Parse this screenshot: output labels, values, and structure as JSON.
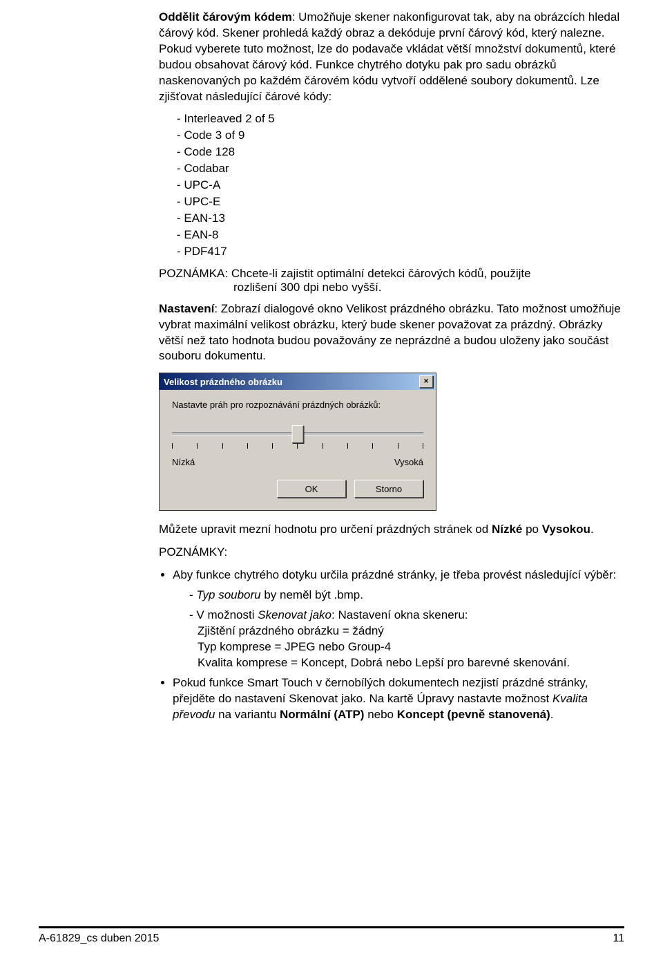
{
  "p1a": "Oddělit čárovým kódem",
  "p1b": ": Umožňuje skener nakonfigurovat tak, aby na obrázcích hledal čárový kód. Skener prohledá každý obraz a dekóduje první čárový kód, který nalezne. Pokud vyberete tuto možnost, lze do podavače vkládat větší množství dokumentů, které budou obsahovat čárový kód. Funkce chytrého dotyku pak pro sadu obrázků naskenovaných po každém čárovém kódu vytvoří oddělené soubory dokumentů. Lze zjišťovat následující čárové kódy:",
  "barcodes": [
    "Interleaved 2 of 5",
    "Code 3 of 9",
    "Code 128",
    "Codabar",
    "UPC-A",
    "UPC-E",
    "EAN-13",
    "EAN-8",
    "PDF417"
  ],
  "note1a": "POZNÁMKA: Chcete-li zajistit optimální detekci čárových kódů, použijte",
  "note1b": "rozlišení 300 dpi nebo vyšší.",
  "p2a": "Nastavení",
  "p2b": ": Zobrazí dialogové okno Velikost prázdného obrázku. Tato možnost umožňuje vybrat maximální velikost obrázku, který bude skener považovat za prázdný. Obrázky větší než tato hodnota budou považovány ze neprázdné a budou uloženy jako součást souboru dokumentu.",
  "dialog": {
    "title": "Velikost prázdného obrázku",
    "text": "Nastavte práh pro rozpoznávání prázdných obrázků:",
    "low": "Nízká",
    "high": "Vysoká",
    "ok": "OK",
    "cancel": "Storno"
  },
  "p3a": "Můžete upravit mezní hodnotu pro určení prázdných stránek od ",
  "p3b": "Nízké",
  "p3c": " po ",
  "p3d": "Vysokou",
  "p3e": ".",
  "notes_label": "POZNÁMKY:",
  "b1": "Aby funkce chytrého dotyku určila prázdné stránky, je třeba provést následující výběr:",
  "d1a": "Typ souboru",
  "d1b": " by neměl být .bmp.",
  "d2a": "V možnosti ",
  "d2b": "Skenovat jako",
  "d2c": ": Nastavení okna skeneru:",
  "d2_l1": "Zjištění prázdného obrázku = žádný",
  "d2_l2": "Typ komprese = JPEG nebo Group-4",
  "d2_l3": "Kvalita komprese = Koncept, Dobrá nebo Lepší pro barevné skenování.",
  "b2a": "Pokud funkce Smart Touch v černobílých dokumentech nezjistí prázdné stránky, přejděte do nastavení Skenovat jako. Na kartě Úpravy nastavte možnost ",
  "b2b": "Kvalita převodu",
  "b2c": " na variantu ",
  "b2d": "Normální (ATP)",
  "b2e": " nebo ",
  "b2f": "Koncept (pevně stanovená)",
  "b2g": ".",
  "footer_left": "A-61829_cs  duben 2015",
  "footer_right": "11"
}
